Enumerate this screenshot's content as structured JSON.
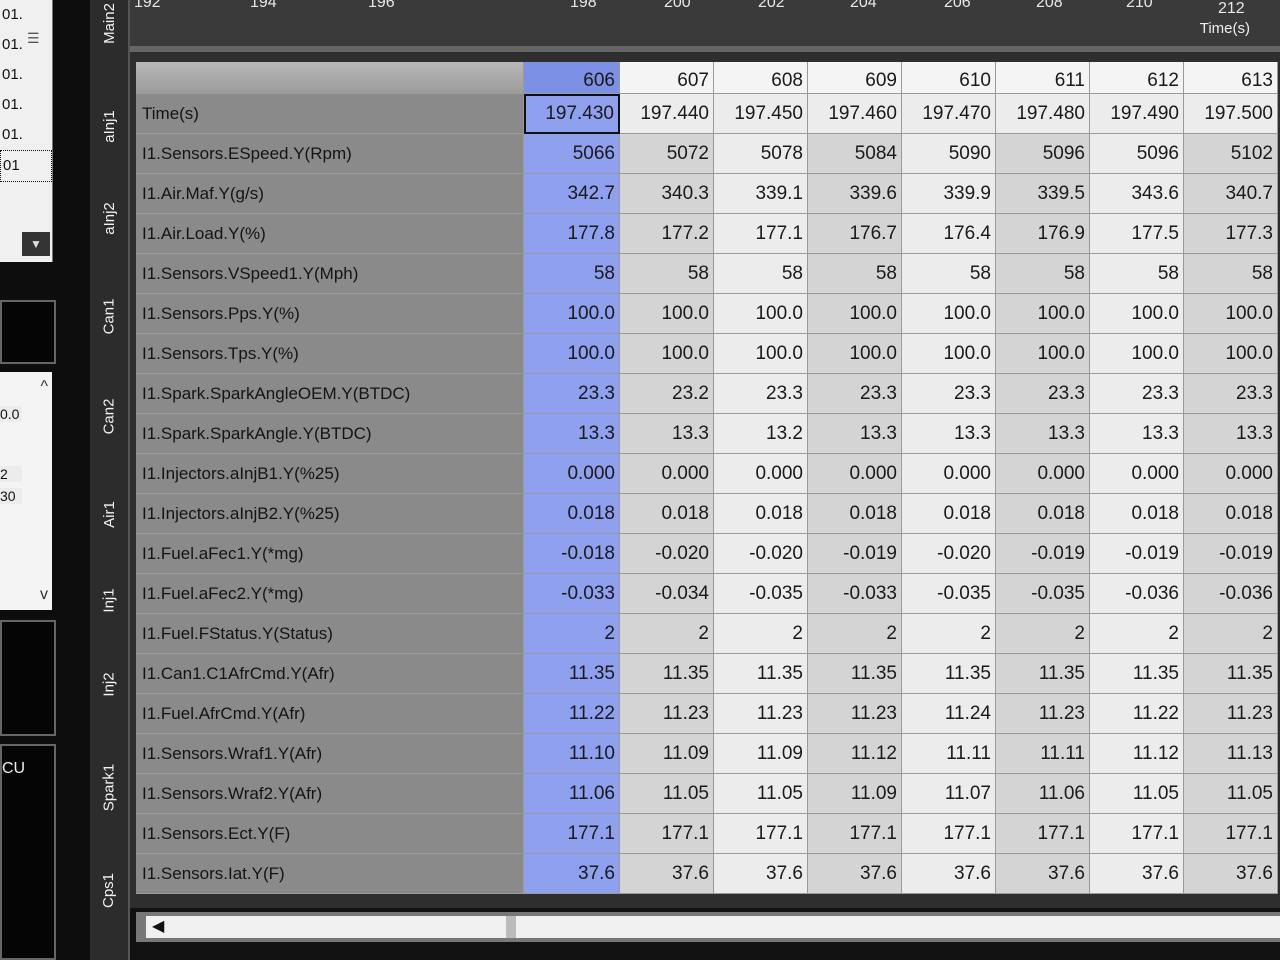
{
  "left_panel": {
    "list_items": [
      "01.",
      "01.",
      "01.",
      "01.",
      "01.",
      "01"
    ],
    "mid_values": [
      "0.0",
      "2",
      "30"
    ],
    "ecu_label": "CU"
  },
  "tabs": [
    "Main2",
    "aInj1",
    "aInj2",
    "Can1",
    "Can2",
    "Air1",
    "Inj1",
    "Inj2",
    "Spark1",
    "Cps1"
  ],
  "top_axis": {
    "ticks": [
      "192",
      "194",
      "196",
      "198",
      "200",
      "202",
      "204",
      "206",
      "208",
      "210",
      "212"
    ],
    "title": "Time(s)"
  },
  "grid": {
    "header_label": "",
    "time_label": "Time(s)",
    "columns": [
      "606",
      "607",
      "608",
      "609",
      "610",
      "611",
      "612",
      "613"
    ],
    "times": [
      "197.430",
      "197.440",
      "197.450",
      "197.460",
      "197.470",
      "197.480",
      "197.490",
      "197.500"
    ],
    "rows": [
      {
        "label": "I1.Sensors.ESpeed.Y(Rpm)",
        "values": [
          "5066",
          "5072",
          "5078",
          "5084",
          "5090",
          "5096",
          "5096",
          "5102"
        ]
      },
      {
        "label": "I1.Air.Maf.Y(g/s)",
        "values": [
          "342.7",
          "340.3",
          "339.1",
          "339.6",
          "339.9",
          "339.5",
          "343.6",
          "340.7"
        ]
      },
      {
        "label": "I1.Air.Load.Y(%)",
        "values": [
          "177.8",
          "177.2",
          "177.1",
          "176.7",
          "176.4",
          "176.9",
          "177.5",
          "177.3"
        ]
      },
      {
        "label": "I1.Sensors.VSpeed1.Y(Mph)",
        "values": [
          "58",
          "58",
          "58",
          "58",
          "58",
          "58",
          "58",
          "58"
        ]
      },
      {
        "label": "I1.Sensors.Pps.Y(%)",
        "values": [
          "100.0",
          "100.0",
          "100.0",
          "100.0",
          "100.0",
          "100.0",
          "100.0",
          "100.0"
        ]
      },
      {
        "label": "I1.Sensors.Tps.Y(%)",
        "values": [
          "100.0",
          "100.0",
          "100.0",
          "100.0",
          "100.0",
          "100.0",
          "100.0",
          "100.0"
        ]
      },
      {
        "label": "I1.Spark.SparkAngleOEM.Y(BTDC)",
        "values": [
          "23.3",
          "23.2",
          "23.3",
          "23.3",
          "23.3",
          "23.3",
          "23.3",
          "23.3"
        ]
      },
      {
        "label": "I1.Spark.SparkAngle.Y(BTDC)",
        "values": [
          "13.3",
          "13.3",
          "13.2",
          "13.3",
          "13.3",
          "13.3",
          "13.3",
          "13.3"
        ]
      },
      {
        "label": "I1.Injectors.aInjB1.Y(%25)",
        "values": [
          "0.000",
          "0.000",
          "0.000",
          "0.000",
          "0.000",
          "0.000",
          "0.000",
          "0.000"
        ]
      },
      {
        "label": "I1.Injectors.aInjB2.Y(%25)",
        "values": [
          "0.018",
          "0.018",
          "0.018",
          "0.018",
          "0.018",
          "0.018",
          "0.018",
          "0.018"
        ]
      },
      {
        "label": "I1.Fuel.aFec1.Y(*mg)",
        "values": [
          "-0.018",
          "-0.020",
          "-0.020",
          "-0.019",
          "-0.020",
          "-0.019",
          "-0.019",
          "-0.019"
        ]
      },
      {
        "label": "I1.Fuel.aFec2.Y(*mg)",
        "values": [
          "-0.033",
          "-0.034",
          "-0.035",
          "-0.033",
          "-0.035",
          "-0.035",
          "-0.036",
          "-0.036"
        ]
      },
      {
        "label": "I1.Fuel.FStatus.Y(Status)",
        "values": [
          "2",
          "2",
          "2",
          "2",
          "2",
          "2",
          "2",
          "2"
        ]
      },
      {
        "label": "I1.Can1.C1AfrCmd.Y(Afr)",
        "values": [
          "11.35",
          "11.35",
          "11.35",
          "11.35",
          "11.35",
          "11.35",
          "11.35",
          "11.35"
        ]
      },
      {
        "label": "I1.Fuel.AfrCmd.Y(Afr)",
        "values": [
          "11.22",
          "11.23",
          "11.23",
          "11.23",
          "11.24",
          "11.23",
          "11.22",
          "11.23"
        ]
      },
      {
        "label": "I1.Sensors.Wraf1.Y(Afr)",
        "values": [
          "11.10",
          "11.09",
          "11.09",
          "11.12",
          "11.11",
          "11.11",
          "11.12",
          "11.13"
        ]
      },
      {
        "label": "I1.Sensors.Wraf2.Y(Afr)",
        "values": [
          "11.06",
          "11.05",
          "11.05",
          "11.09",
          "11.07",
          "11.06",
          "11.05",
          "11.05"
        ]
      },
      {
        "label": "I1.Sensors.Ect.Y(F)",
        "values": [
          "177.1",
          "177.1",
          "177.1",
          "177.1",
          "177.1",
          "177.1",
          "177.1",
          "177.1"
        ]
      },
      {
        "label": "I1.Sensors.Iat.Y(F)",
        "values": [
          "37.6",
          "37.6",
          "37.6",
          "37.6",
          "37.6",
          "37.6",
          "37.6",
          "37.6"
        ]
      }
    ]
  },
  "scrollbar": {
    "left_arrow": "◀"
  },
  "colors": {
    "selected_column": "#7c90e6",
    "label_column": "#8a8a8a",
    "cell_light": "#ececec",
    "cell_dark": "#d4d4d4"
  }
}
